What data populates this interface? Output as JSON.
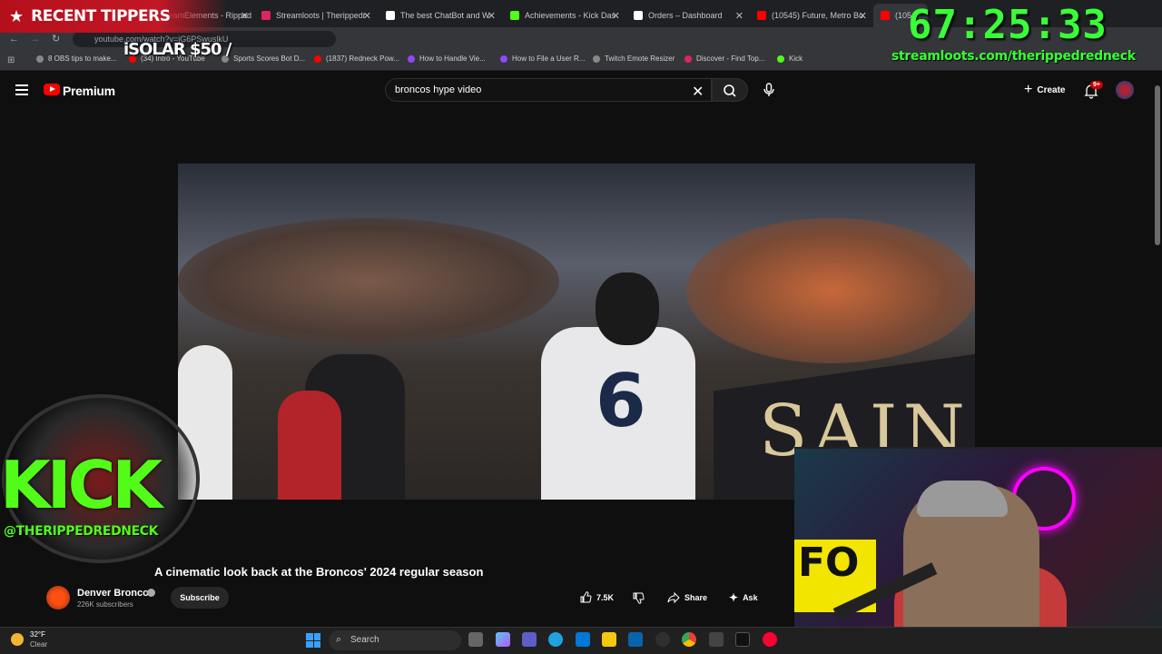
{
  "browser": {
    "tabs": [
      {
        "label": "StreamElements - Ripped",
        "color": "#6a6a6a"
      },
      {
        "label": "Streamloots | Therippedr",
        "color": "#e0245e"
      },
      {
        "label": "The best ChatBot and W",
        "color": "#ffffff"
      },
      {
        "label": "Achievements - Kick Das",
        "color": "#53fc18"
      },
      {
        "label": "Orders – Dashboard",
        "color": "#ffffff"
      },
      {
        "label": "(10545) Future, Metro Bo",
        "color": "#ff0000"
      },
      {
        "label": "(10545",
        "color": "#ff0000"
      }
    ],
    "url": "youtube.com/watch?v=jG6PSwuslkU",
    "bookmarks": [
      {
        "label": "8 OBS tips to make...",
        "color": "#888888"
      },
      {
        "label": "(34) Intro - YouTube",
        "color": "#ff0000"
      },
      {
        "label": "Sports Scores Bot D...",
        "color": "#888888"
      },
      {
        "label": "(1837) Redneck Pow...",
        "color": "#ff0000"
      },
      {
        "label": "How to Handle Vie...",
        "color": "#9147ff"
      },
      {
        "label": "How to File a User R...",
        "color": "#9147ff"
      },
      {
        "label": "Twitch Emote Resizer",
        "color": "#888888"
      },
      {
        "label": "Discover - Find Top...",
        "color": "#e0245e"
      },
      {
        "label": "Kick",
        "color": "#53fc18"
      }
    ]
  },
  "youtube": {
    "logo_label": "Premium",
    "search_value": "broncos hype video",
    "create_label": "Create",
    "notifications_badge": "9+",
    "video_title": "A cinematic look back at the Broncos' 2024 regular season",
    "channel_name": "Denver Broncos",
    "subscribers": "226K subscribers",
    "subscribe_label": "Subscribe",
    "likes": "7.5K",
    "share_label": "Share",
    "ask_label": "Ask",
    "jersey_number": "6",
    "banner_text": "SAIN"
  },
  "overlays": {
    "recent_tippers": "RECENT TIPPERS",
    "tipper_line": "iSOLAR $50 /",
    "timer": "67:25:33",
    "stream_url": "streamloots.com/therippedredneck",
    "kick_text": "KICK",
    "kick_handle": "@THERIPPEDREDNECK",
    "webcam_sign": "FO"
  },
  "taskbar": {
    "temperature": "32°F",
    "condition": "Clear",
    "search_placeholder": "Search",
    "app_icons": [
      "file-explorer",
      "copilot",
      "teams",
      "edge",
      "store",
      "outlook",
      "obs",
      "chrome",
      "capcut",
      "terminal",
      "youtube-music"
    ]
  },
  "colors": {
    "youtube_red": "#ff0000",
    "kick_green": "#53fc18",
    "timer_green": "#38ff38",
    "tipper_red": "#c21724"
  }
}
